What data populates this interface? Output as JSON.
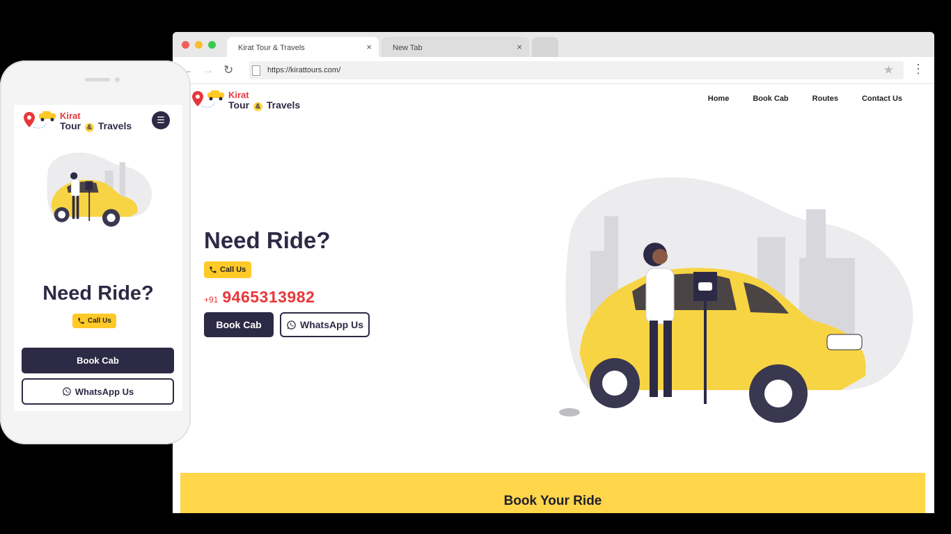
{
  "browser": {
    "tabs": [
      {
        "label": "Kirat Tour & Travels",
        "close": "×"
      },
      {
        "label": "New Tab",
        "close": "×"
      }
    ],
    "url": "https://kirattours.com/"
  },
  "site": {
    "logo": {
      "line1": "Kirat",
      "line2a": "Tour",
      "amp": "&",
      "line2b": "Travels"
    },
    "nav": [
      "Home",
      "Book Cab",
      "Routes",
      "Contact Us"
    ],
    "hero": {
      "title": "Need Ride?",
      "call_label": "Call Us",
      "country_code": "+91",
      "phone": "9465313982",
      "book_label": "Book Cab",
      "whatsapp_label": "WhatsApp Us"
    },
    "band_title": "Book Your Ride"
  },
  "mobile": {
    "logo": {
      "line1": "Kirat",
      "line2a": "Tour",
      "amp": "&",
      "line2b": "Travels"
    },
    "title": "Need Ride?",
    "call_label": "Call Us",
    "book_label": "Book Cab",
    "whatsapp_label": "WhatsApp Us"
  },
  "colors": {
    "accent_yellow": "#ffd54a",
    "dark": "#2d2a45",
    "brand_red": "#e8373a"
  },
  "icons": [
    "back-arrow-icon",
    "forward-arrow-icon",
    "reload-icon",
    "page-icon",
    "star-icon",
    "kebab-menu-icon",
    "phone-icon",
    "whatsapp-icon",
    "hamburger-icon",
    "location-pin-icon",
    "taxi-icon"
  ]
}
